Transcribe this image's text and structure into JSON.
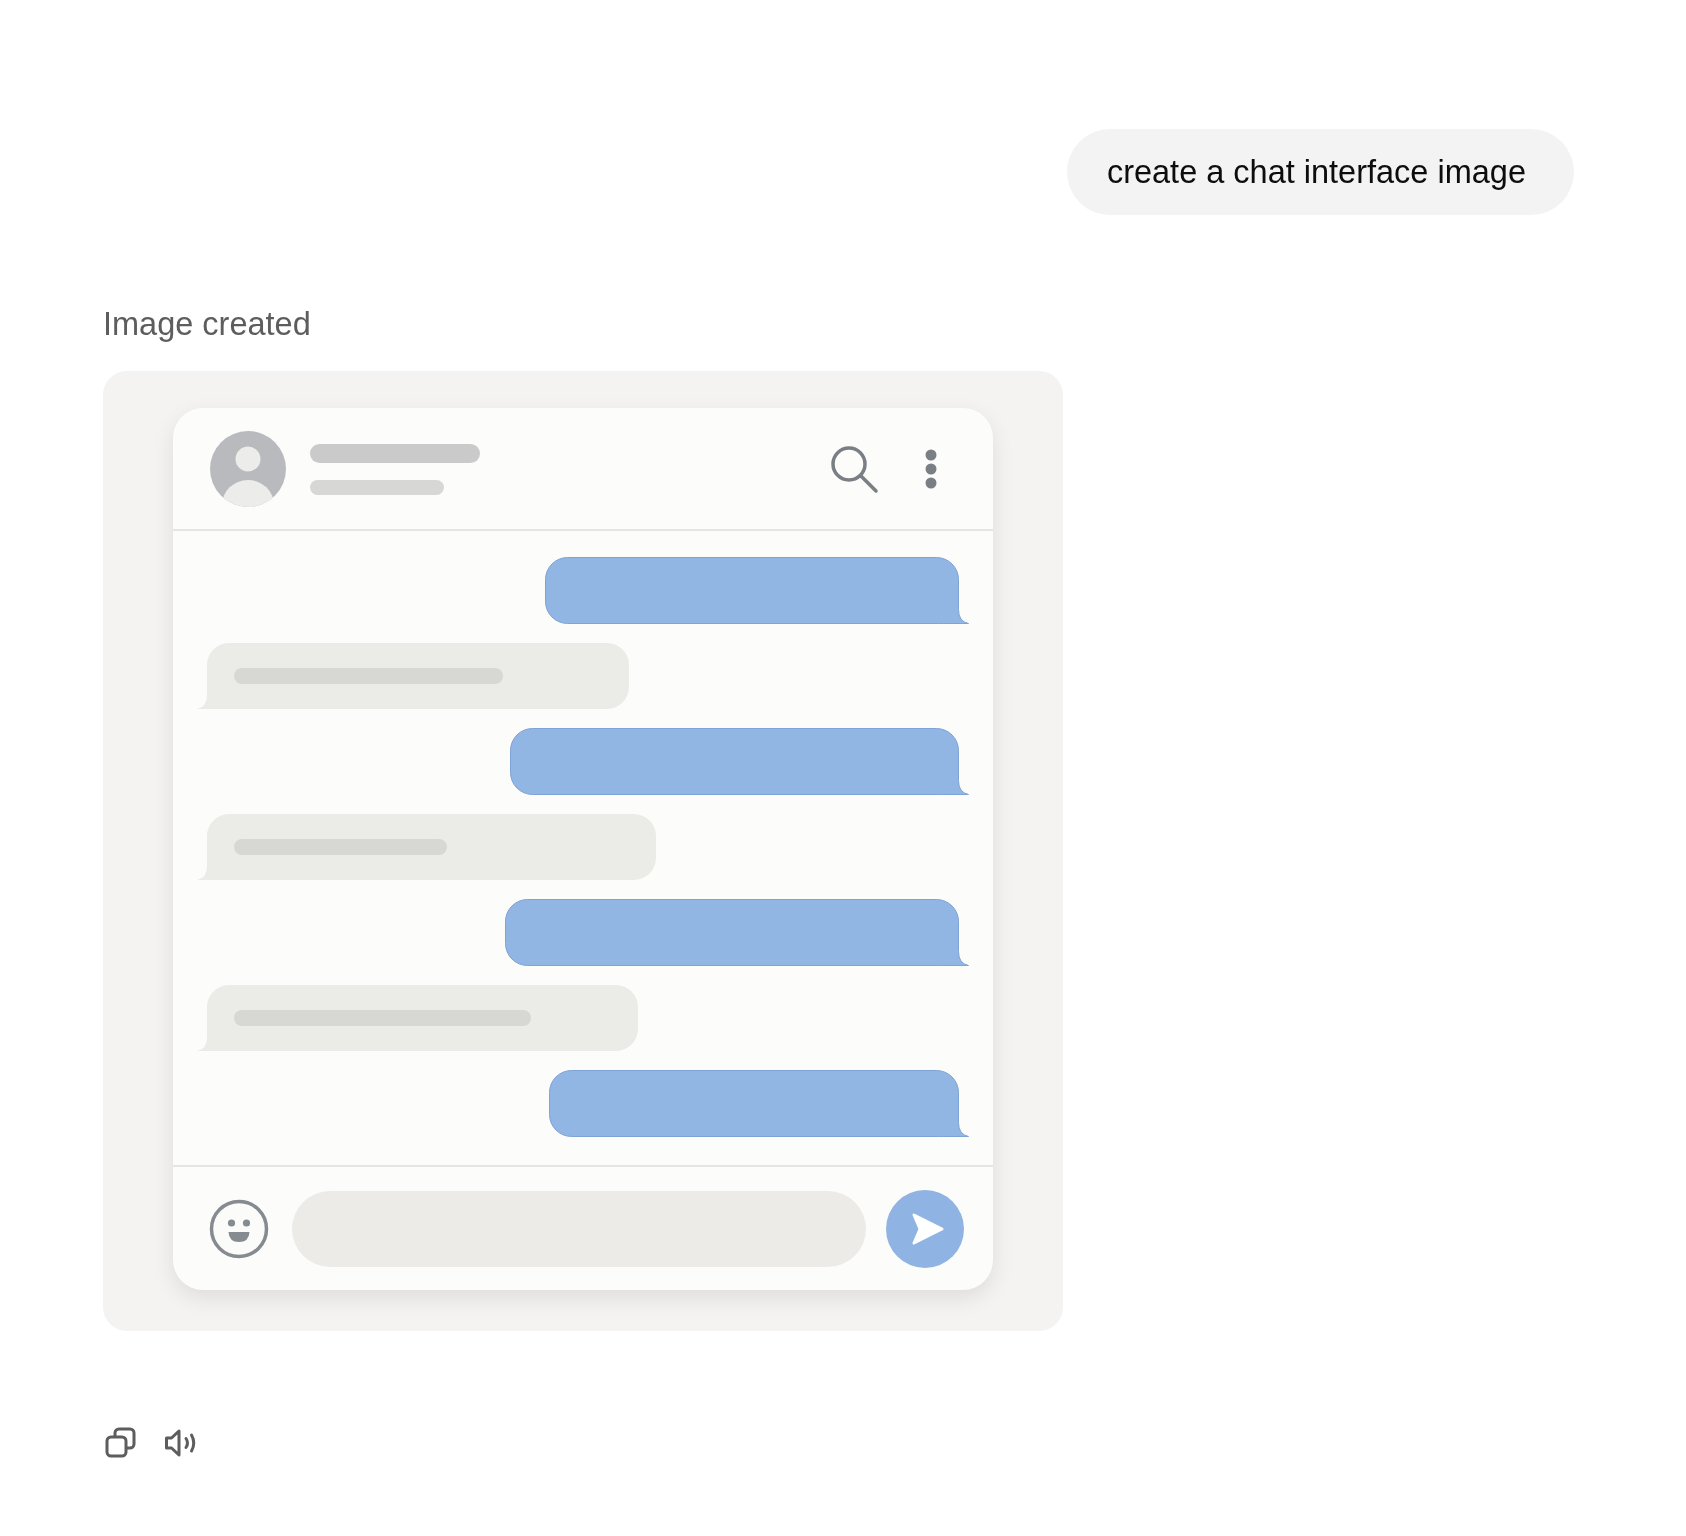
{
  "user_message": {
    "text": "create a chat interface image"
  },
  "response": {
    "status": "Image created",
    "image": {
      "messages": [
        {
          "kind": "sent"
        },
        {
          "kind": "received"
        },
        {
          "kind": "sent"
        },
        {
          "kind": "received"
        },
        {
          "kind": "sent"
        },
        {
          "kind": "received"
        },
        {
          "kind": "sent"
        }
      ]
    },
    "actions": [
      {
        "kind": "copy"
      },
      {
        "kind": "speaker"
      }
    ]
  }
}
